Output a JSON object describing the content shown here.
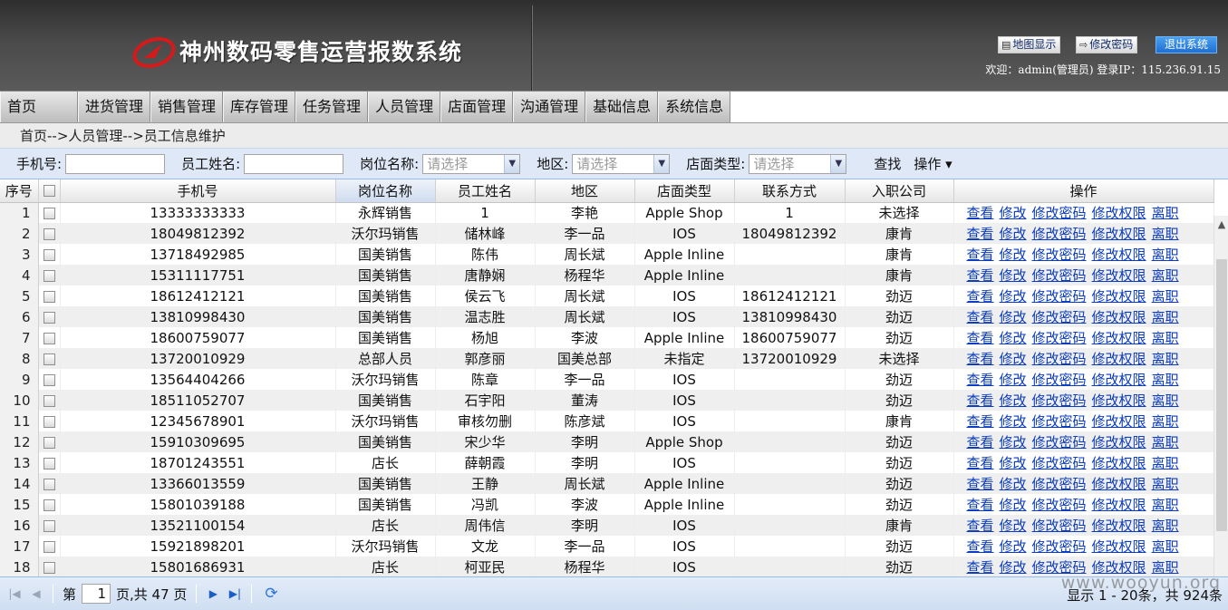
{
  "header": {
    "title": "神州数码零售运营报数系统",
    "buttons": [
      {
        "label": "地图显示",
        "icon": "map-icon"
      },
      {
        "label": "修改密码",
        "icon": "edit-icon"
      },
      {
        "label": "退出系统",
        "icon": ""
      }
    ],
    "welcome": "欢迎：admin(管理员) 登录IP：115.236.91.15"
  },
  "nav": [
    "首页",
    "进货管理",
    "销售管理",
    "库存管理",
    "任务管理",
    "人员管理",
    "店面管理",
    "沟通管理",
    "基础信息",
    "系统信息"
  ],
  "breadcrumb": "首页-->人员管理-->员工信息维护",
  "filters": {
    "phone_label": "手机号:",
    "name_label": "员工姓名:",
    "position_label": "岗位名称:",
    "region_label": "地区:",
    "store_type_label": "店面类型:",
    "placeholder": "请选择",
    "search": "查找",
    "ops": "操作 ▾"
  },
  "table": {
    "columns": [
      "序号",
      "",
      "手机号",
      "岗位名称",
      "员工姓名",
      "地区",
      "店面类型",
      "联系方式",
      "入职公司",
      "操作"
    ],
    "actions": [
      "查看",
      "修改",
      "修改密码",
      "修改权限",
      "离职"
    ],
    "rows": [
      [
        "1",
        "13333333333",
        "永辉销售",
        "1",
        "李艳",
        "Apple Shop",
        "1",
        "未选择"
      ],
      [
        "2",
        "18049812392",
        "沃尔玛销售",
        "储林峰",
        "李一品",
        "IOS",
        "18049812392",
        "康肯"
      ],
      [
        "3",
        "13718492985",
        "国美销售",
        "陈伟",
        "周长斌",
        "Apple Inline",
        "",
        "康肯"
      ],
      [
        "4",
        "15311117751",
        "国美销售",
        "唐静娴",
        "杨程华",
        "Apple Inline",
        "",
        "康肯"
      ],
      [
        "5",
        "18612412121",
        "国美销售",
        "侯云飞",
        "周长斌",
        "IOS",
        "18612412121",
        "劲迈"
      ],
      [
        "6",
        "13810998430",
        "国美销售",
        "温志胜",
        "周长斌",
        "IOS",
        "13810998430",
        "劲迈"
      ],
      [
        "7",
        "18600759077",
        "国美销售",
        "杨旭",
        "李波",
        "Apple Inline",
        "18600759077",
        "劲迈"
      ],
      [
        "8",
        "13720010929",
        "总部人员",
        "郭彦丽",
        "国美总部",
        "未指定",
        "13720010929",
        "未选择"
      ],
      [
        "9",
        "13564404266",
        "沃尔玛销售",
        "陈章",
        "李一品",
        "IOS",
        "",
        "劲迈"
      ],
      [
        "10",
        "18511052707",
        "国美销售",
        "石宇阳",
        "董涛",
        "IOS",
        "",
        "劲迈"
      ],
      [
        "11",
        "12345678901",
        "沃尔玛销售",
        "审核勿删",
        "陈彦斌",
        "IOS",
        "",
        "康肯"
      ],
      [
        "12",
        "15910309695",
        "国美销售",
        "宋少华",
        "李明",
        "Apple Shop",
        "",
        "劲迈"
      ],
      [
        "13",
        "18701243551",
        "店长",
        "薛朝霞",
        "李明",
        "IOS",
        "",
        "劲迈"
      ],
      [
        "14",
        "13366013559",
        "国美销售",
        "王静",
        "周长斌",
        "Apple Inline",
        "",
        "劲迈"
      ],
      [
        "15",
        "15801039188",
        "国美销售",
        "冯凯",
        "李波",
        "Apple Inline",
        "",
        "劲迈"
      ],
      [
        "16",
        "13521100154",
        "店长",
        "周伟信",
        "李明",
        "IOS",
        "",
        "康肯"
      ],
      [
        "17",
        "15921898201",
        "沃尔玛销售",
        "文龙",
        "李一品",
        "IOS",
        "",
        "劲迈"
      ],
      [
        "18",
        "15801686931",
        "店长",
        "柯亚民",
        "杨程华",
        "IOS",
        "",
        "劲迈"
      ]
    ]
  },
  "pager": {
    "page_prefix": "第",
    "page": "1",
    "page_suffix": "页,共 47 页",
    "info": "显示 1 - 20条，共 924条"
  },
  "watermark": "www.wooyun.org",
  "colors": {
    "link": "#0b3cc1",
    "filter_bg": "#dfe8f6",
    "header_bg": "#4a4a4a"
  }
}
